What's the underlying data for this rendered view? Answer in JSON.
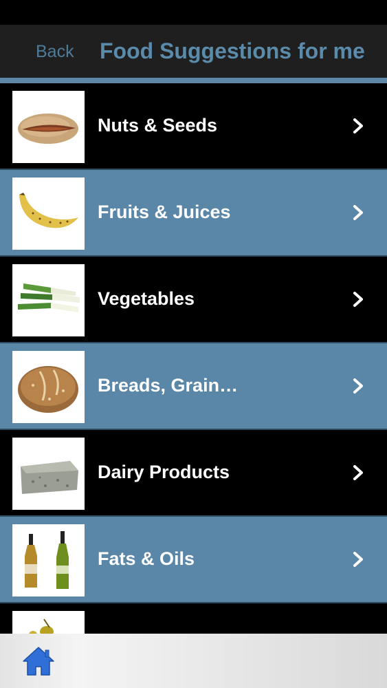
{
  "nav": {
    "back_label": "Back",
    "title": "Food Suggestions for me"
  },
  "colors": {
    "accent": "#5a86a7",
    "nav_text": "#5b8bab",
    "home_icon": "#2f6fd6"
  },
  "list": {
    "items": [
      {
        "label": "Nuts & Seeds",
        "icon": "pistachio-icon"
      },
      {
        "label": "Fruits & Juices",
        "icon": "banana-icon"
      },
      {
        "label": "Vegetables",
        "icon": "leek-icon"
      },
      {
        "label": "Breads, Grain…",
        "icon": "bread-icon"
      },
      {
        "label": "Dairy Products",
        "icon": "cheese-icon"
      },
      {
        "label": "Fats & Oils",
        "icon": "oil-bottles-icon"
      },
      {
        "label": "",
        "icon": "olives-icon"
      }
    ]
  },
  "tab_bar": {
    "home_icon": "home-icon"
  }
}
